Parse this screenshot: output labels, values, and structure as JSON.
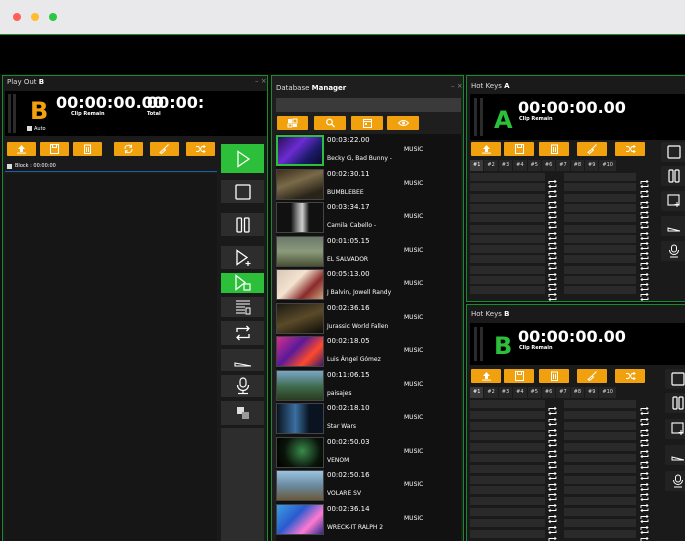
{
  "window": {
    "dot_colors": [
      "#ff5f57",
      "#febc2e",
      "#28c840"
    ]
  },
  "playout": {
    "title_prefix": "Play Out",
    "title_bold": "B",
    "tools": "– ×",
    "letter": "B",
    "letter_color": "#f2a10e",
    "timecode": "00:00:00.00",
    "timecode2": "00:00:",
    "clip_label": "Clip Remain",
    "total_label": "Total",
    "auto_label": "Auto",
    "block_label": "Block : 00:00:00"
  },
  "database": {
    "title_prefix": "Database",
    "title_bold": "Manager",
    "tools": "– ×",
    "items": [
      {
        "time": "00:03:22.00",
        "title": "Becky G, Bad Bunny -",
        "type": "MUSIC"
      },
      {
        "time": "00:02:30.11",
        "title": "BUMBLEBEE",
        "type": "MUSIC"
      },
      {
        "time": "00:03:34.17",
        "title": "Camila Cabello -",
        "type": "MUSIC"
      },
      {
        "time": "00:01:05.15",
        "title": "EL SALVADOR",
        "type": "MUSIC"
      },
      {
        "time": "00:05:13.00",
        "title": "J Balvin, Jowell Randy",
        "type": "MUSIC"
      },
      {
        "time": "00:02:36.16",
        "title": "Jurassic World Fallen",
        "type": "MUSIC"
      },
      {
        "time": "00:02:18.05",
        "title": "Luis Ángel Gómez",
        "type": "MUSIC"
      },
      {
        "time": "00:11:06.15",
        "title": "paisajes",
        "type": "MUSIC"
      },
      {
        "time": "00:02:18.10",
        "title": "Star Wars",
        "type": "MUSIC"
      },
      {
        "time": "00:02:50.03",
        "title": "VENOM",
        "type": "MUSIC"
      },
      {
        "time": "00:02:50.16",
        "title": "VOLARE SV",
        "type": "MUSIC"
      },
      {
        "time": "00:02:36.14",
        "title": "WRECK-IT RALPH 2",
        "type": "MUSIC"
      }
    ]
  },
  "hotkeys_a": {
    "title_prefix": "Hot Keys",
    "title_bold": "A",
    "letter": "A",
    "letter_color": "#2cbf3a",
    "timecode": "00:00:00.00",
    "clip_label": "Clip Remain",
    "tabs": [
      "#1",
      "#2",
      "#3",
      "#4",
      "#5",
      "#6",
      "#7",
      "#8",
      "#9",
      "#10"
    ]
  },
  "hotkeys_b": {
    "title_prefix": "Hot Keys",
    "title_bold": "B",
    "letter": "B",
    "letter_color": "#2cbf3a",
    "timecode": "00:00:00.00",
    "clip_label": "Clip Remain",
    "tabs": [
      "#1",
      "#2",
      "#3",
      "#4",
      "#5",
      "#6",
      "#7",
      "#8",
      "#9",
      "#10"
    ]
  },
  "colors": {
    "accent_orange": "#f2a10e",
    "accent_green": "#2cbf3a",
    "border_green": "#1b8a2a"
  }
}
